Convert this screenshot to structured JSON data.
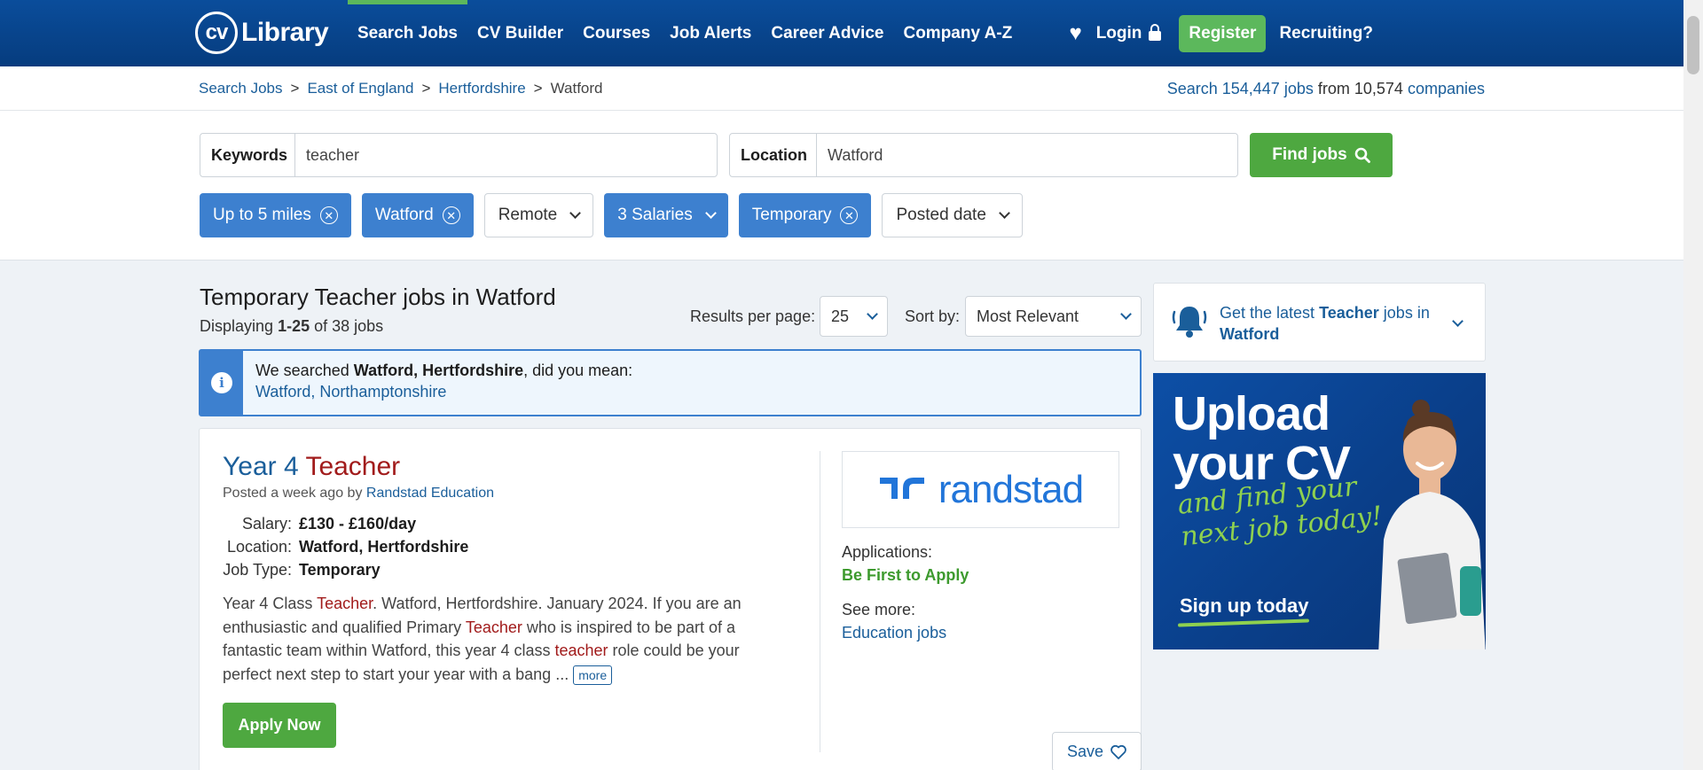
{
  "header": {
    "logo_cv": "cv",
    "logo_library": "Library",
    "nav": [
      {
        "label": "Search Jobs",
        "active": true
      },
      {
        "label": "CV Builder",
        "active": false
      },
      {
        "label": "Courses",
        "active": false
      },
      {
        "label": "Job Alerts",
        "active": false
      },
      {
        "label": "Career Advice",
        "active": false
      },
      {
        "label": "Company A-Z",
        "active": false
      }
    ],
    "login": "Login",
    "register": "Register",
    "recruiting": "Recruiting?"
  },
  "breadcrumb": {
    "items": [
      "Search Jobs",
      "East of England",
      "Hertfordshire"
    ],
    "current": "Watford",
    "separator": ">"
  },
  "stats": {
    "prefix": "Search",
    "jobs": "154,447 jobs",
    "from": "from",
    "count": "10,574",
    "companies": "companies"
  },
  "search": {
    "keywords_label": "Keywords",
    "keywords_value": "teacher",
    "location_label": "Location",
    "location_value": "Watford",
    "find_label": "Find jobs"
  },
  "filters": [
    {
      "label": "Up to 5 miles",
      "active": true,
      "control": "remove"
    },
    {
      "label": "Watford",
      "active": true,
      "control": "remove"
    },
    {
      "label": "Remote",
      "active": false,
      "control": "dropdown"
    },
    {
      "label": "3 Salaries",
      "active": true,
      "control": "dropdown"
    },
    {
      "label": "Temporary",
      "active": true,
      "control": "remove"
    },
    {
      "label": "Posted date",
      "active": false,
      "control": "dropdown"
    }
  ],
  "results": {
    "title": "Temporary Teacher jobs in Watford",
    "display_prefix": "Displaying",
    "display_range": "1-25",
    "display_suffix": "of 38 jobs",
    "per_page_label": "Results per page:",
    "per_page_value": "25",
    "sort_label": "Sort by:",
    "sort_value": "Most Relevant"
  },
  "did_you_mean": {
    "prefix": "We searched",
    "searched": "Watford, Hertfordshire",
    "suffix": ", did you mean:",
    "suggestion": "Watford, Northamptonshire"
  },
  "job": {
    "title_prefix": "Year 4",
    "title_highlight": "Teacher",
    "posted_prefix": "Posted a week ago by",
    "company": "Randstad Education",
    "salary_label": "Salary:",
    "salary": "£130 - £160/day",
    "location_label": "Location:",
    "location": "Watford, Hertfordshire",
    "type_label": "Job Type:",
    "type": "Temporary",
    "desc_1": "Year 4 Class ",
    "desc_hl1": "Teacher",
    "desc_2": ". Watford, Hertfordshire. January 2024. If you are an enthusiastic and qualified Primary ",
    "desc_hl2": "Teacher",
    "desc_3": " who is inspired to be part of a fantastic team within Watford, this year 4 class ",
    "desc_hl3": "teacher",
    "desc_4": " role could be your perfect next step to start your year with a bang ... ",
    "more": "more",
    "apply": "Apply Now",
    "logo_word": "randstad",
    "applications_label": "Applications:",
    "applications_value": "Be First to Apply",
    "see_more_label": "See more:",
    "see_more_link": "Education jobs",
    "save": "Save"
  },
  "alert": {
    "prefix": "Get the latest",
    "keyword": "Teacher",
    "middle": "jobs in",
    "location": "Watford"
  },
  "ad": {
    "line1": "Upload",
    "line2": "your CV",
    "sub1": "and find your",
    "sub2": "next job today!",
    "cta": "Sign up today"
  },
  "colors": {
    "header_blue": "#063c7e",
    "link_blue": "#1a5e9a",
    "chip_blue": "#3d80cf",
    "green": "#4ea840",
    "highlight_red": "#a11b1b"
  }
}
